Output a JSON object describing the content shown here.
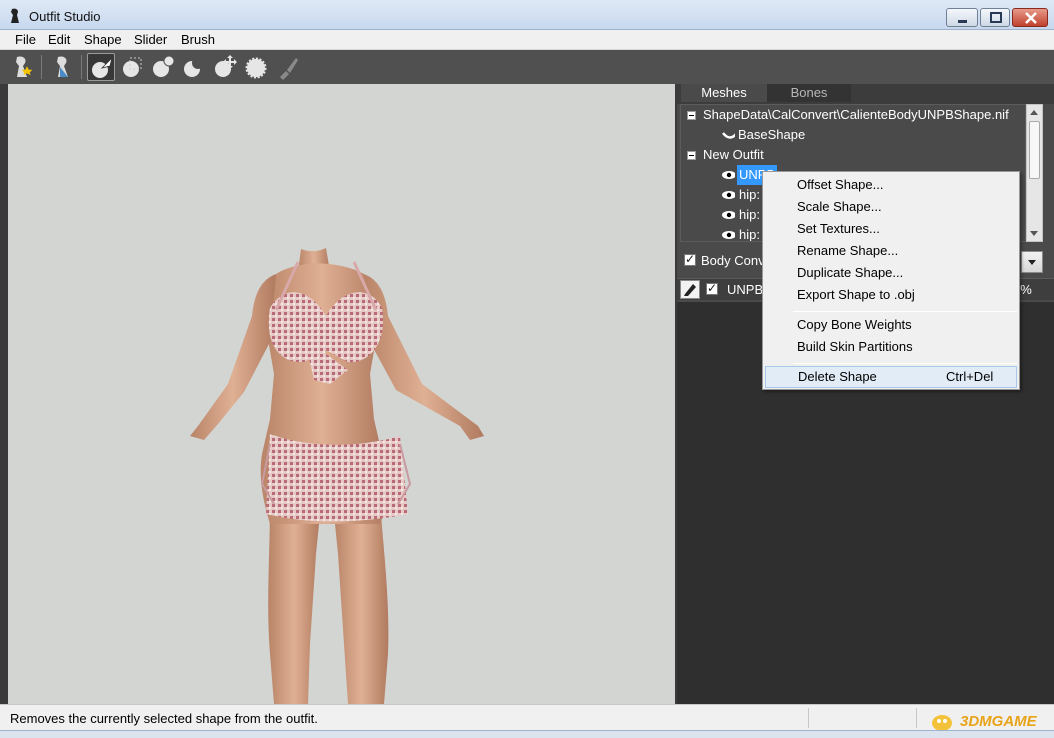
{
  "window": {
    "title": "Outfit Studio"
  },
  "menu": {
    "items": [
      "File",
      "Edit",
      "Shape",
      "Slider",
      "Brush"
    ]
  },
  "toolbar": {
    "tools": [
      "conform-icon",
      "conform-shape-icon",
      "select-brush-icon",
      "mask-brush-icon",
      "inflate-brush-icon",
      "deflate-brush-icon",
      "move-brush-icon",
      "smooth-brush-icon",
      "weight-paint-icon"
    ]
  },
  "tabs": {
    "meshes": "Meshes",
    "bones": "Bones"
  },
  "tree": {
    "reference_file": "ShapeData\\CalConvert\\CalienteBodyUNPBShape.nif",
    "reference_shape": "BaseShape",
    "outfit_root": "New Outfit",
    "outfit_items": [
      "UNPB",
      "hip:",
      "hip:",
      "hip:"
    ]
  },
  "slider_panel": {
    "header_label": "Body Conv",
    "slider_name": "UNPB",
    "slider_value": "0%"
  },
  "context_menu": {
    "group1": [
      "Offset Shape...",
      "Scale Shape...",
      "Set Textures...",
      "Rename Shape...",
      "Duplicate Shape...",
      "Export Shape to .obj"
    ],
    "group2": [
      "Copy Bone Weights",
      "Build Skin Partitions"
    ],
    "delete_label": "Delete Shape",
    "delete_shortcut": "Ctrl+Del"
  },
  "statusbar": {
    "text": "Removes the currently selected shape from the outfit."
  },
  "watermark": {
    "text": "3DMGAME"
  },
  "colors": {
    "selection": "#3399ff",
    "panel_dark": "#4a4a4a",
    "viewport_bg": "#d3d5d3"
  }
}
